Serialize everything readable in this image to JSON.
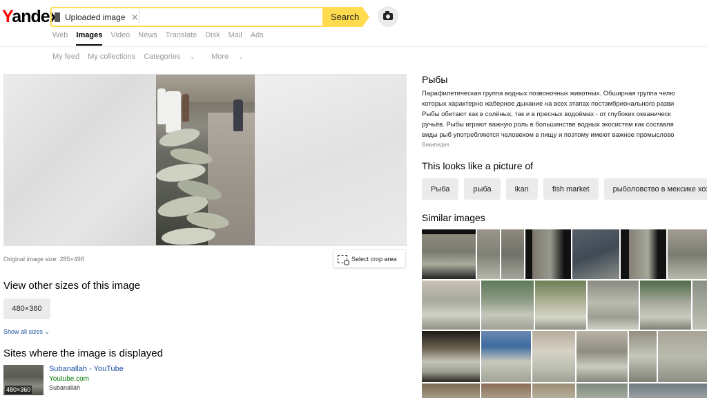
{
  "brand": {
    "logo_first": "Y",
    "logo_rest": "andex"
  },
  "search": {
    "chip_label": "Uploaded image",
    "chip_close": "✕",
    "button_label": "Search"
  },
  "nav": {
    "items": [
      "Web",
      "Images",
      "Video",
      "News",
      "Translate",
      "Disk",
      "Mail",
      "Ads"
    ],
    "active": "Images"
  },
  "subnav": {
    "my_feed": "My feed",
    "my_collections": "My collections",
    "categories": "Categories",
    "more": "More",
    "caret": "⌄"
  },
  "image_info": {
    "original_size": "Original image size: 285×498",
    "crop_label": "Select crop area"
  },
  "other_sizes": {
    "title": "View other sizes of this image",
    "size": "480×360",
    "show_all": "Show all sizes",
    "show_all_caret": "⌄"
  },
  "sites": {
    "title": "Sites where the image is displayed",
    "items": [
      {
        "thumb_label": "480×360",
        "title": "Subanallah - YouTube",
        "domain": "Youtube.com",
        "description": "Subanallah"
      }
    ]
  },
  "entity": {
    "title": "Рыбы",
    "lines": [
      "Парафилетическая группа водных позвоночных животных. Обширная группа челю",
      "которых характерно жаберное дыхание на всех этапах постэмбрионального разви",
      "Рыбы обитают как в солёных, так и в пресных водоёмах - от глубоких океаническ",
      "ручьёв. Рыбы играют важную роль в большинстве водных экосистем как составля",
      "виды рыб употребляются человеком в пищу и поэтому имеют важное промыслово"
    ],
    "source": "Википедия"
  },
  "looks_like": {
    "title": "This looks like a picture of",
    "tags": [
      "Рыба",
      "рыба",
      "ikan",
      "fish market",
      "рыболовство в мексике хозяй"
    ]
  },
  "similar": {
    "title": "Similar images"
  },
  "colors": {
    "accent_yellow": "#ffdb4d",
    "link_blue": "#1a4f9e",
    "domain_green": "#007700",
    "logo_red": "#ff0000"
  }
}
